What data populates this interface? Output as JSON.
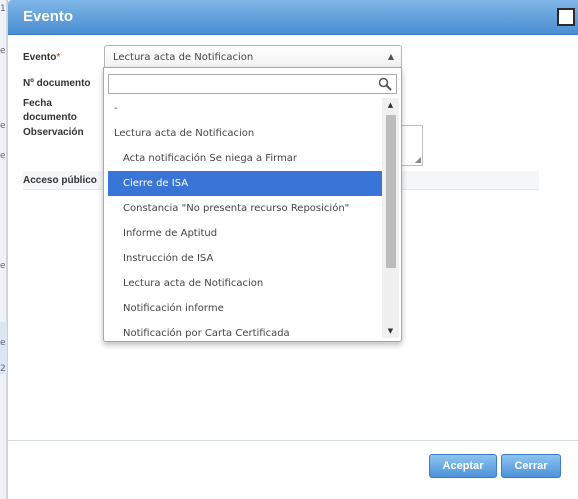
{
  "background": {
    "edge_glyphs": [
      "1",
      "e",
      "e",
      "e",
      "e",
      "e",
      "2"
    ]
  },
  "dialog": {
    "title": "Evento",
    "fields": {
      "evento_label": "Evento",
      "required_mark": "*",
      "evento_value": "Lectura acta de Notificacion",
      "numero_documento_label": "Nº documento",
      "fecha_documento_label_1": "Fecha",
      "fecha_documento_label_2": "documento",
      "observacion_label": "Observación",
      "acceso_publico_label": "Acceso público"
    },
    "dropdown": {
      "search_value": "",
      "options": [
        {
          "label": "-",
          "level": "top",
          "highlighted": false
        },
        {
          "label": "Lectura acta de Notificacion",
          "level": "top",
          "highlighted": false
        },
        {
          "label": "Acta notificación Se niega a Firmar",
          "level": "sub",
          "highlighted": false
        },
        {
          "label": "Cierre de ISA",
          "level": "sub",
          "highlighted": true
        },
        {
          "label": "Constancia \"No presenta recurso Reposición\"",
          "level": "sub",
          "highlighted": false
        },
        {
          "label": "Informe de Aptitud",
          "level": "sub",
          "highlighted": false
        },
        {
          "label": "Instrucción de ISA",
          "level": "sub",
          "highlighted": false
        },
        {
          "label": "Lectura acta de Notificacion",
          "level": "sub",
          "highlighted": false
        },
        {
          "label": "Notificación informe",
          "level": "sub",
          "highlighted": false
        },
        {
          "label": "Notificación por Carta Certificada",
          "level": "sub",
          "highlighted": false
        }
      ]
    },
    "buttons": {
      "aceptar": "Aceptar",
      "cerrar": "Cerrar"
    },
    "colors": {
      "titlebar": "#4a8ed2",
      "highlight": "#3875d7",
      "button": "#4d93d8",
      "required": "#d02020"
    }
  }
}
